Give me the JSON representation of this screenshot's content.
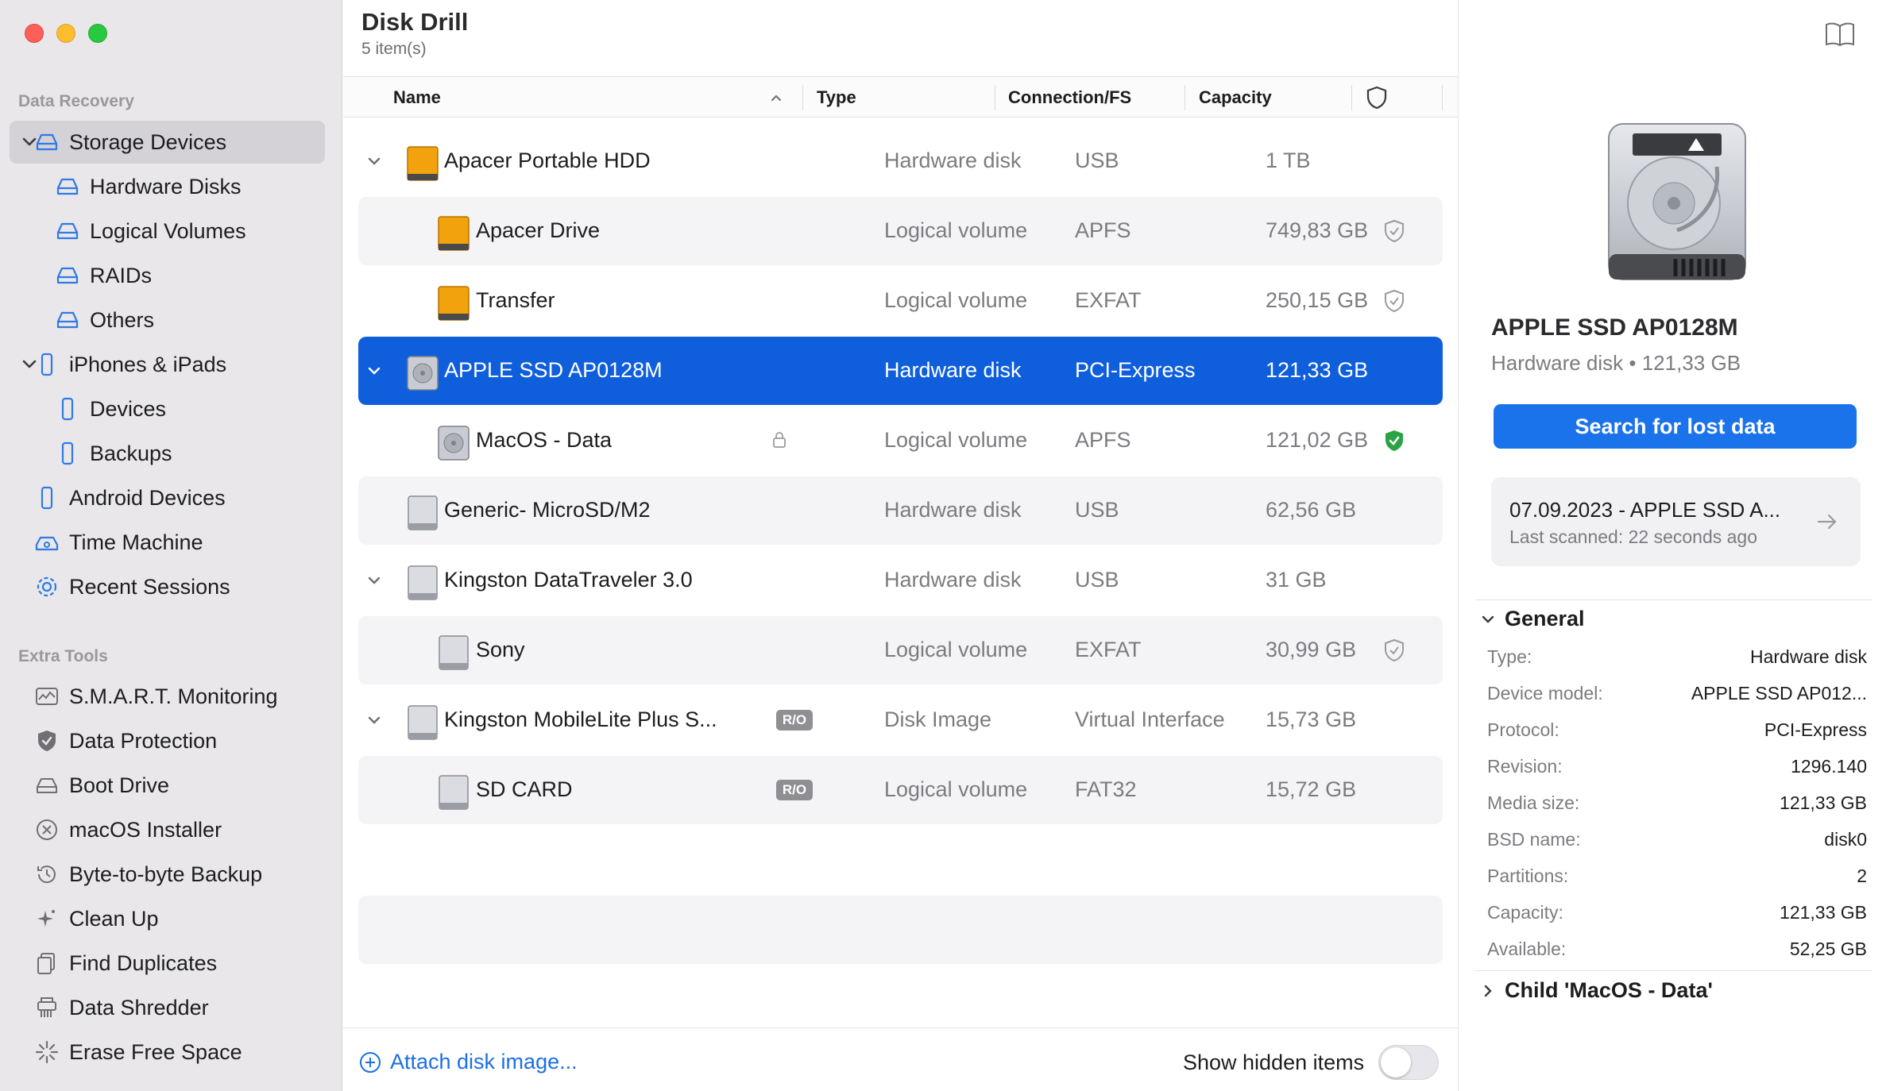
{
  "window": {
    "title": "Disk Drill",
    "item_count": "5 item(s)"
  },
  "sidebar": {
    "data_recovery_label": "Data Recovery",
    "items": [
      {
        "label": "Storage Devices",
        "icon": "hard-drive-icon"
      },
      {
        "label": "Hardware Disks",
        "icon": "hard-drive-icon"
      },
      {
        "label": "Logical Volumes",
        "icon": "hard-drive-icon"
      },
      {
        "label": "RAIDs",
        "icon": "hard-drive-icon"
      },
      {
        "label": "Others",
        "icon": "hard-drive-icon"
      },
      {
        "label": "iPhones & iPads",
        "icon": "phone-icon"
      },
      {
        "label": "Devices",
        "icon": "phone-icon"
      },
      {
        "label": "Backups",
        "icon": "phone-icon"
      },
      {
        "label": "Android Devices",
        "icon": "phone-icon"
      },
      {
        "label": "Time Machine",
        "icon": "time-machine-icon"
      },
      {
        "label": "Recent Sessions",
        "icon": "gear-icon"
      }
    ],
    "extra_tools_label": "Extra Tools",
    "tools": [
      {
        "label": "S.M.A.R.T. Monitoring",
        "icon": "monitoring-chart-icon"
      },
      {
        "label": "Data Protection",
        "icon": "shield-icon"
      },
      {
        "label": "Boot Drive",
        "icon": "drive-icon"
      },
      {
        "label": "macOS Installer",
        "icon": "x-circle-icon"
      },
      {
        "label": "Byte-to-byte Backup",
        "icon": "history-icon"
      },
      {
        "label": "Clean Up",
        "icon": "sparkle-icon"
      },
      {
        "label": "Find Duplicates",
        "icon": "duplicate-files-icon"
      },
      {
        "label": "Data Shredder",
        "icon": "shredder-icon"
      },
      {
        "label": "Erase Free Space",
        "icon": "burst-icon"
      }
    ]
  },
  "table": {
    "headers": {
      "name": "Name",
      "type": "Type",
      "connection": "Connection/FS",
      "capacity": "Capacity"
    },
    "rows": [
      {
        "name": "Apacer Portable HDD",
        "type": "Hardware disk",
        "fs": "USB",
        "capacity": "1 TB"
      },
      {
        "name": "Apacer Drive",
        "type": "Logical volume",
        "fs": "APFS",
        "capacity": "749,83 GB"
      },
      {
        "name": "Transfer",
        "type": "Logical volume",
        "fs": "EXFAT",
        "capacity": "250,15 GB"
      },
      {
        "name": "APPLE SSD AP0128M",
        "type": "Hardware disk",
        "fs": "PCI-Express",
        "capacity": "121,33 GB"
      },
      {
        "name": "MacOS - Data",
        "type": "Logical volume",
        "fs": "APFS",
        "capacity": "121,02 GB"
      },
      {
        "name": "Generic- MicroSD/M2",
        "type": "Hardware disk",
        "fs": "USB",
        "capacity": "62,56 GB"
      },
      {
        "name": "Kingston DataTraveler 3.0",
        "type": "Hardware disk",
        "fs": "USB",
        "capacity": "31 GB"
      },
      {
        "name": "Sony",
        "type": "Logical volume",
        "fs": "EXFAT",
        "capacity": "30,99 GB"
      },
      {
        "name": "Kingston MobileLite Plus S...",
        "type": "Disk Image",
        "fs": "Virtual Interface",
        "capacity": "15,73 GB",
        "badge": "R/O"
      },
      {
        "name": "SD CARD",
        "type": "Logical volume",
        "fs": "FAT32",
        "capacity": "15,72 GB",
        "badge": "R/O"
      }
    ]
  },
  "footer": {
    "attach_label": "Attach disk image...",
    "show_hidden_label": "Show hidden items",
    "show_hidden_on": false
  },
  "details": {
    "title": "APPLE SSD AP0128M",
    "subtitle": "Hardware disk • 121,33 GB",
    "search_button": "Search for lost data",
    "session_title": "07.09.2023 - APPLE SSD A...",
    "session_sub": "Last scanned: 22 seconds ago",
    "general_label": "General",
    "properties": [
      {
        "k": "Type:",
        "v": "Hardware disk"
      },
      {
        "k": "Device model:",
        "v": "APPLE SSD AP012..."
      },
      {
        "k": "Protocol:",
        "v": "PCI-Express"
      },
      {
        "k": "Revision:",
        "v": "1296.140"
      },
      {
        "k": "Media size:",
        "v": "121,33 GB"
      },
      {
        "k": "BSD name:",
        "v": "disk0"
      },
      {
        "k": "Partitions:",
        "v": "2"
      },
      {
        "k": "Capacity:",
        "v": "121,33 GB"
      },
      {
        "k": "Available:",
        "v": "52,25 GB"
      }
    ],
    "child_label": "Child 'MacOS - Data'"
  },
  "colors": {
    "accent": "#1a73ea",
    "selection": "#0f5fdc",
    "protected": "#2aa345",
    "hdd_orange": "#f2a20c"
  }
}
